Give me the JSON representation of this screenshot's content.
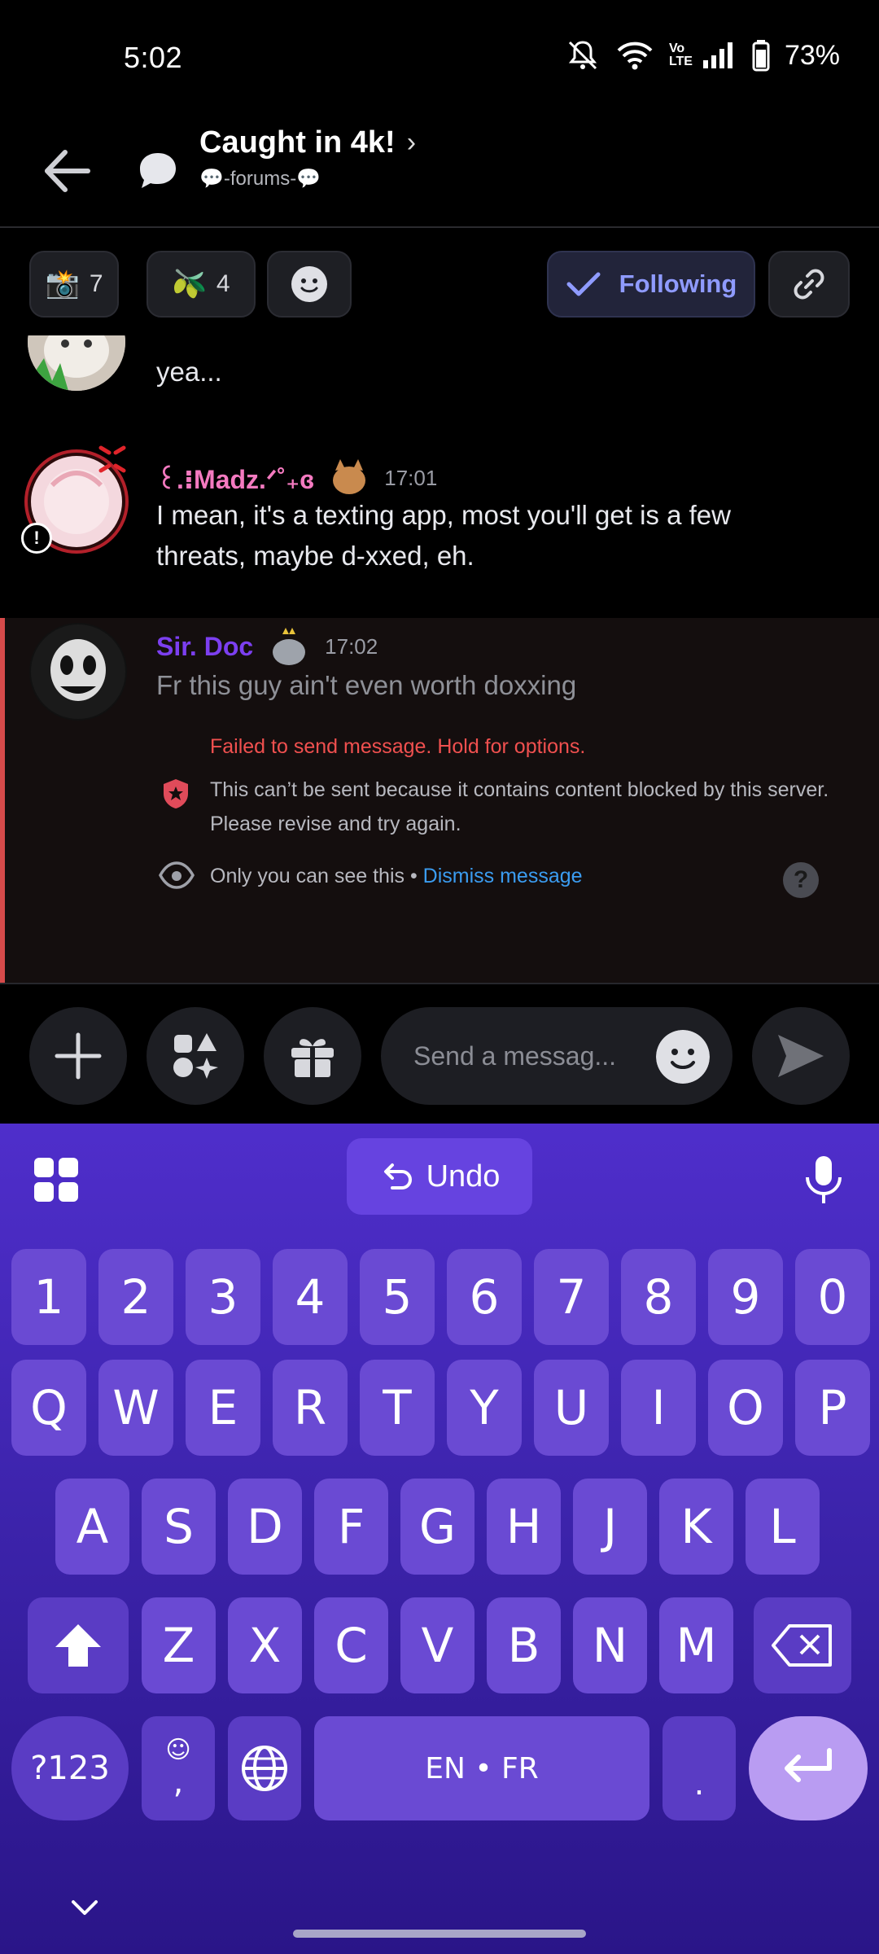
{
  "status_bar": {
    "time": "5:02",
    "battery": "73%",
    "network_label": "Vo LTE"
  },
  "header": {
    "title": "Caught in 4k!",
    "chevron": "›",
    "subtitle": "💬-forums-💬"
  },
  "reactions": [
    {
      "emoji": "📸",
      "count": "7"
    },
    {
      "emoji": "🫒",
      "count": "4"
    }
  ],
  "follow_label": "Following",
  "messages": [
    {
      "text": "yea..."
    },
    {
      "username": "꒰.⁝Madz.ᐟ˚₊ɞ",
      "time": "17:01",
      "text_line1": "I mean, it's a texting app, most you'll get is a few",
      "text_line2": "threats, maybe d-xxed, eh."
    },
    {
      "username": "Sir. Doc",
      "time": "17:02",
      "text": "Fr this guy ain't even worth doxxing"
    }
  ],
  "failed": {
    "error": "Failed to send message. Hold for options.",
    "blocked_line1": "This can’t be sent because it contains content blocked by this server.",
    "blocked_line2": "Please revise and try again.",
    "only_you": "Only you can see this • ",
    "dismiss": "Dismiss message"
  },
  "composer": {
    "placeholder": "Send a messag..."
  },
  "keyboard": {
    "undo_label": "Undo",
    "row_numbers": [
      "1",
      "2",
      "3",
      "4",
      "5",
      "6",
      "7",
      "8",
      "9",
      "0"
    ],
    "row_q": [
      "Q",
      "W",
      "E",
      "R",
      "T",
      "Y",
      "U",
      "I",
      "O",
      "P"
    ],
    "row_a": [
      "A",
      "S",
      "D",
      "F",
      "G",
      "H",
      "J",
      "K",
      "L"
    ],
    "row_z": [
      "Z",
      "X",
      "C",
      "V",
      "B",
      "N",
      "M"
    ],
    "symbols_label": "?123",
    "comma_label": ",",
    "space_label": "EN • FR",
    "period_label": "."
  },
  "colors": {
    "accent": "#8f9bff",
    "error": "#f0504f",
    "link": "#3b9cf0",
    "madz": "#f47ac0",
    "doc": "#7c3ff0"
  }
}
